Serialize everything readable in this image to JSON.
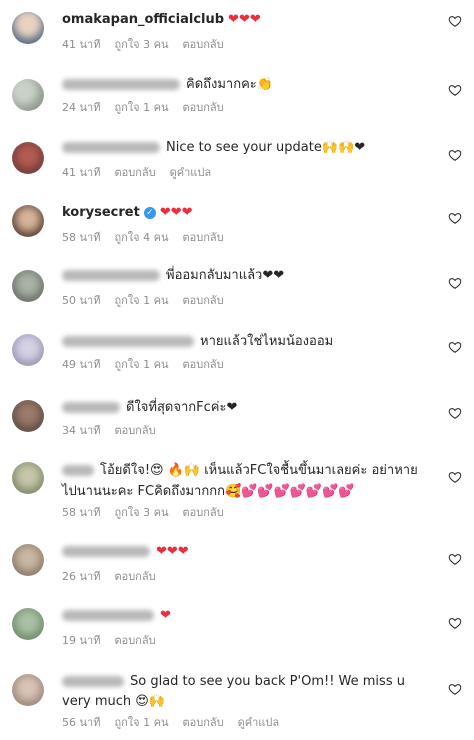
{
  "comments": [
    {
      "user": "omakapan_officialclub",
      "text": "❤❤❤",
      "time": "41 นาที",
      "likes": "ถูกใจ 3 คน",
      "reply": "ตอบกลับ",
      "translate": ""
    },
    {
      "user": "",
      "text": "คิดถึงมากคะ👏",
      "time": "24 นาที",
      "likes": "ถูกใจ 1 คน",
      "reply": "ตอบกลับ",
      "translate": ""
    },
    {
      "user": "",
      "text": "Nice to see your update🙌🙌❤",
      "time": "41 นาที",
      "likes": "",
      "reply": "ตอบกลับ",
      "translate": "ดูคำแปล"
    },
    {
      "user": "korysecret",
      "text": "❤❤❤",
      "time": "58 นาที",
      "likes": "ถูกใจ 4 คน",
      "reply": "ตอบกลับ",
      "translate": ""
    },
    {
      "user": "",
      "text": "พี่ออมกลับมาแล้ว❤❤",
      "time": "50 นาที",
      "likes": "ถูกใจ 1 คน",
      "reply": "ตอบกลับ",
      "translate": ""
    },
    {
      "user": "",
      "text": "หายแล้วใช่ไหมน้องออม",
      "time": "49 นาที",
      "likes": "ถูกใจ 1 คน",
      "reply": "ตอบกลับ",
      "translate": ""
    },
    {
      "user": "",
      "text": "ดีใจที่สุดจากFcค่ะ❤",
      "time": "34 นาที",
      "likes": "",
      "reply": "ตอบกลับ",
      "translate": ""
    },
    {
      "user": "",
      "text": "โอ้ยดีใจ!😍 🔥🙌 เห็นแล้วFCใจชื้นขึ้นมาเลยค่ะ อย่าหายไปนานนะคะ FCคิดถึงมากกก🥰💕💕💕💕💕💕💕",
      "time": "58 นาที",
      "likes": "ถูกใจ 3 คน",
      "reply": "ตอบกลับ",
      "translate": ""
    },
    {
      "user": "",
      "text": "❤❤❤",
      "time": "26 นาที",
      "likes": "",
      "reply": "ตอบกลับ",
      "translate": ""
    },
    {
      "user": "",
      "text": "❤",
      "time": "19 นาที",
      "likes": "",
      "reply": "ตอบกลับ",
      "translate": ""
    },
    {
      "user": "",
      "text": "So glad to see you back P'Om!! We miss u very much 😍🙌",
      "time": "56 นาที",
      "likes": "ถูกใจ 1 คน",
      "reply": "ตอบกลับ",
      "translate": "ดูคำแปล"
    }
  ],
  "colors": {
    "heart": "#ed2c3e",
    "muted": "#8e8e8e",
    "verified": "#3897f0"
  },
  "icons": {
    "like": "heart-outline-icon",
    "verified": "verified-badge-icon"
  }
}
